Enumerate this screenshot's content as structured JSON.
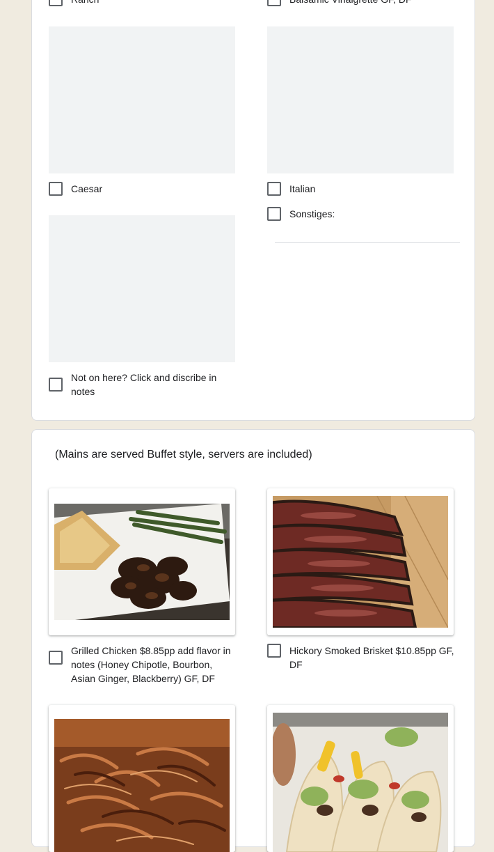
{
  "dressings": {
    "options": [
      {
        "label": "Ranch"
      },
      {
        "label": "Balsamic Vinaigrette GF, DF"
      },
      {
        "label": "Caesar"
      },
      {
        "label": "Italian"
      },
      {
        "label": "Sonstiges:"
      },
      {
        "label": "Not on here? Click and discribe in notes"
      }
    ],
    "other_placeholder": ""
  },
  "mains": {
    "description": "(Mains are served Buffet style, servers are included)",
    "options": [
      {
        "label": "Grilled Chicken $8.85pp add flavor in notes (Honey Chipotle, Bourbon, Asian Ginger, Blackberry) GF, DF",
        "image": "grilled-chicken-photo"
      },
      {
        "label": "Hickory Smoked Brisket $10.85pp GF, DF",
        "image": "smoked-brisket-photo"
      },
      {
        "label": "",
        "image": "pulled-pork-photo"
      },
      {
        "label": "",
        "image": "tacos-photo"
      }
    ]
  },
  "colors": {
    "page_background": "#f0ebe0",
    "card_background": "#ffffff",
    "checkbox_border": "#5f6368",
    "placeholder_fill": "#f1f3f4"
  }
}
